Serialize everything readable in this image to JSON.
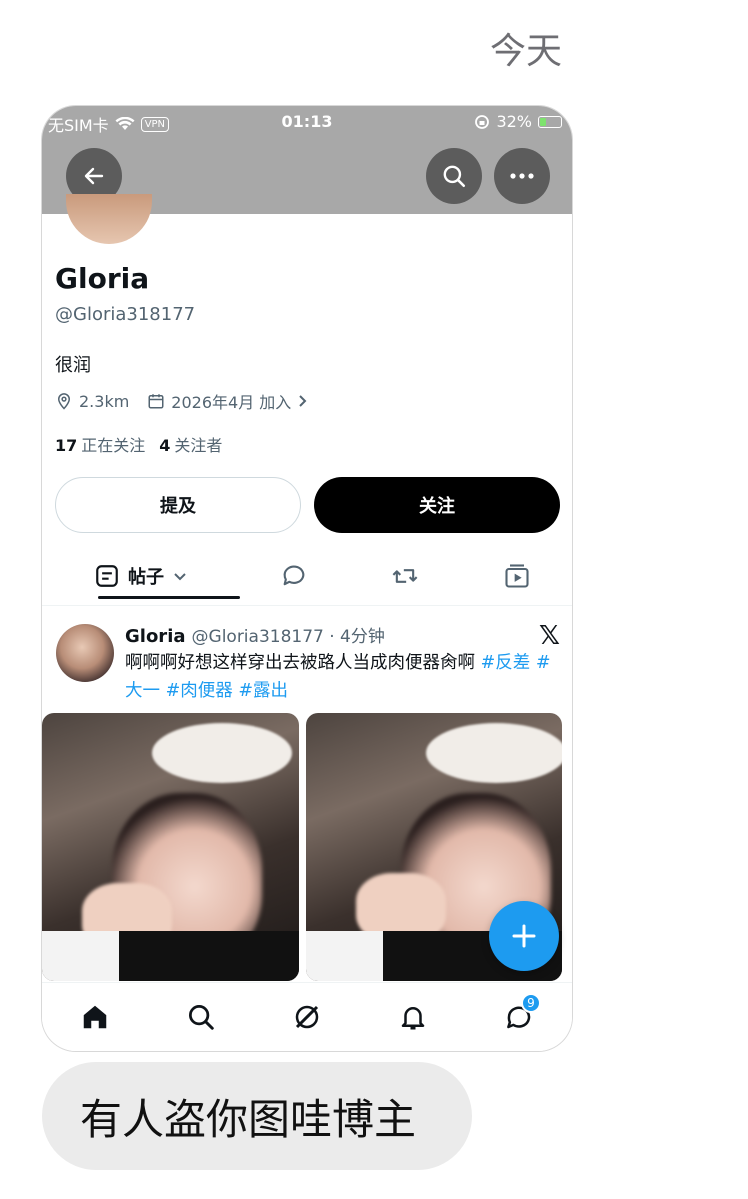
{
  "chat": {
    "date_label": "今天",
    "message": "有人盗你图哇博主"
  },
  "status_bar": {
    "carrier": "无SIM卡",
    "vpn": "VPN",
    "time": "01:13",
    "battery": "32%",
    "battery_level": 0.32
  },
  "profile": {
    "name": "Gloria",
    "handle": "@Gloria318177",
    "bio": "很润",
    "location": "2.3km",
    "joined": "2026年4月 加入",
    "following_count": "17",
    "following_label": "正在关注",
    "followers_count": "4",
    "followers_label": "关注者",
    "mention_button": "提及",
    "follow_button": "关注"
  },
  "tabs": {
    "posts": "帖子"
  },
  "post": {
    "author": "Gloria",
    "meta": "@Gloria318177 · 4分钟",
    "text": "啊啊啊好想这样穿出去被路人当成肉便器肏啊 ",
    "tags": [
      "#反差",
      "#大一",
      "#肉便器",
      "#露出"
    ]
  },
  "bottom_nav": {
    "messages_badge": "9"
  },
  "colors": {
    "accent": "#1d9bf0",
    "statusbar": "#a8a8a8",
    "bubble": "#ebebeb"
  }
}
